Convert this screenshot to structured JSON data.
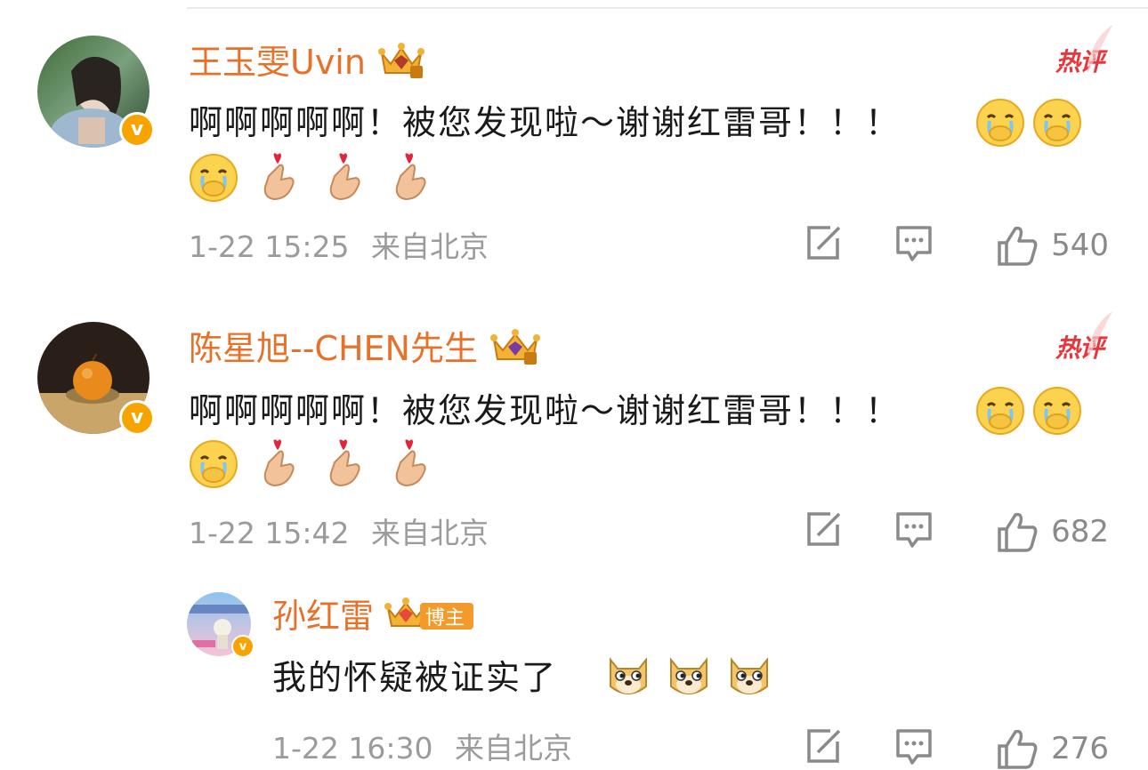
{
  "comments": [
    {
      "username": "王玉雯Uvin",
      "crown_level": "8",
      "hot_label": "热评",
      "text": "啊啊啊啊啊！被您发现啦～谢谢红雷哥！！！",
      "timestamp": "1-22 15:25",
      "location": "来自北京",
      "likes": "540",
      "verified": "v",
      "emojis_inline": [
        "crying-covering-mouth-emoji",
        "crying-covering-mouth-emoji"
      ],
      "emojis_second_line": [
        "crying-covering-mouth-emoji",
        "finger-heart-emoji",
        "finger-heart-emoji",
        "finger-heart-emoji"
      ]
    },
    {
      "username": "陈星旭--CHEN先生",
      "crown_level": "9",
      "hot_label": "热评",
      "text": "啊啊啊啊啊！被您发现啦～谢谢红雷哥！！！",
      "timestamp": "1-22 15:42",
      "location": "来自北京",
      "likes": "682",
      "verified": "v",
      "emojis_inline": [
        "crying-covering-mouth-emoji",
        "crying-covering-mouth-emoji"
      ],
      "emojis_second_line": [
        "crying-covering-mouth-emoji",
        "finger-heart-emoji",
        "finger-heart-emoji",
        "finger-heart-emoji"
      ]
    },
    {
      "username": "孙红雷",
      "crown_level": "7",
      "blogger_tag": "博主",
      "text": "我的怀疑被证实了",
      "timestamp": "1-22 16:30",
      "location": "来自北京",
      "likes": "276",
      "verified": "v",
      "emojis_inline": [
        "doge-emoji",
        "doge-emoji",
        "doge-emoji"
      ]
    }
  ],
  "colors": {
    "username": "#e8712a",
    "hot": "#e8363c",
    "verified": "#f7a300",
    "meta": "#9b9b9b"
  },
  "icons": {
    "repost": "repost-icon",
    "comment": "comment-icon",
    "like": "like-icon"
  }
}
